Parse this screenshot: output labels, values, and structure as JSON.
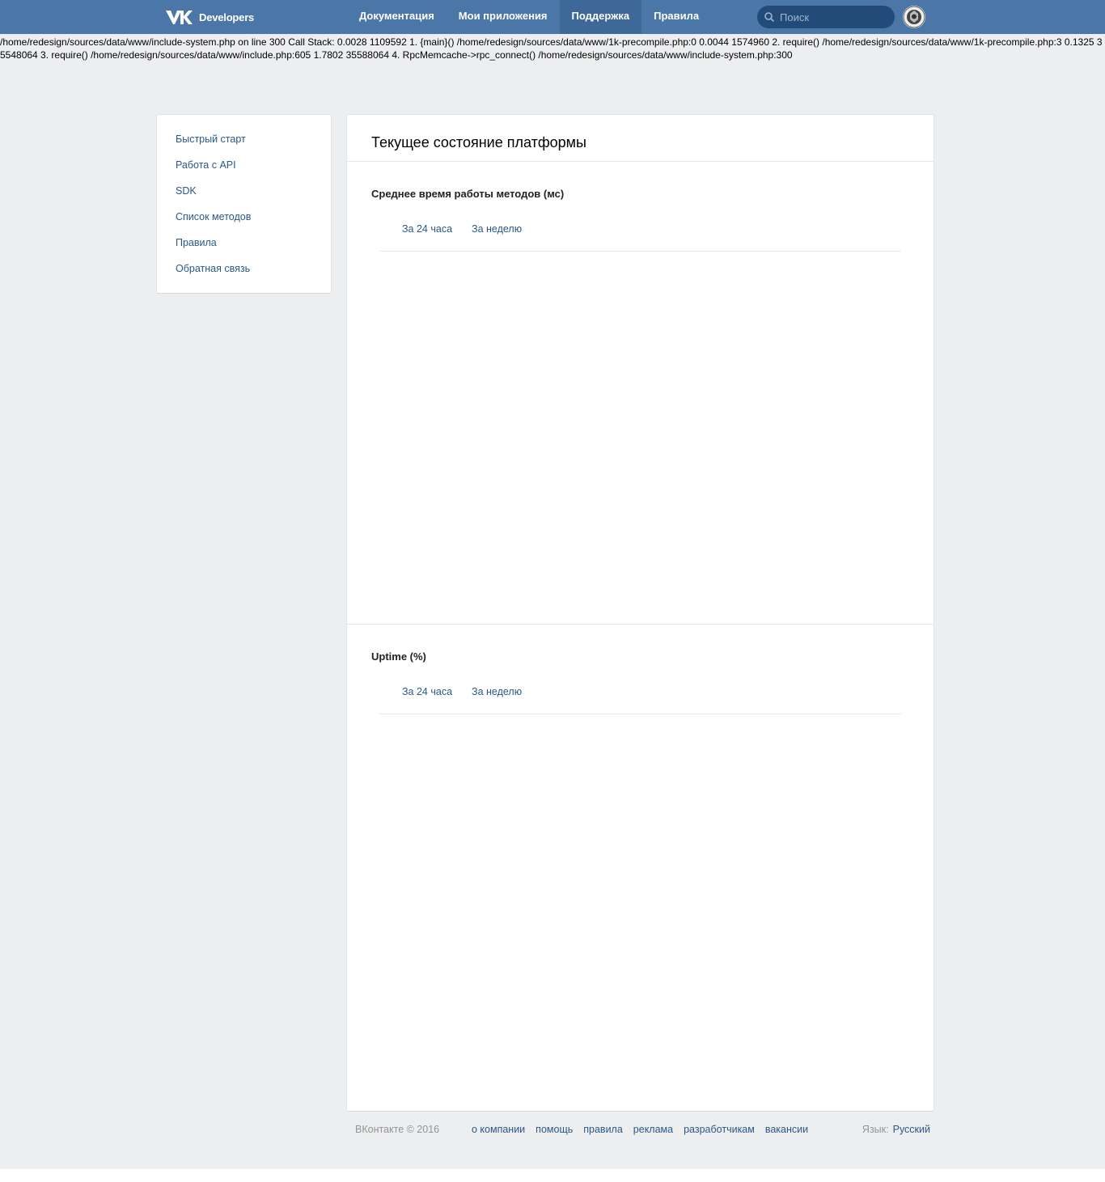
{
  "header": {
    "logo_text": "Developers",
    "nav": [
      {
        "label": "Документация",
        "active": false
      },
      {
        "label": "Мои приложения",
        "active": false
      },
      {
        "label": "Поддержка",
        "active": true
      },
      {
        "label": "Правила",
        "active": false
      }
    ],
    "search_placeholder": "Поиск"
  },
  "error_text": "/home/redesign/sources/data/www/include-system.php on line 300 Call Stack: 0.0028 1109592 1. {main}() /home/redesign/sources/data/www/1k-precompile.php:0 0.0044 1574960 2. require() /home/redesign/sources/data/www/1k-precompile.php:3 0.1325 35548064 3. require() /home/redesign/sources/data/www/include.php:605 1.7802 35588064 4. RpcMemcache->rpc_connect() /home/redesign/sources/data/www/include-system.php:300",
  "sidebar": {
    "items": [
      {
        "label": "Быстрый старт"
      },
      {
        "label": "Работа с API"
      },
      {
        "label": "SDK"
      },
      {
        "label": "Список методов"
      },
      {
        "label": "Правила"
      },
      {
        "label": "Обратная связь"
      }
    ]
  },
  "main": {
    "title": "Текущее состояние платформы",
    "sections": [
      {
        "title": "Среднее время работы методов (мс)",
        "tabs": [
          "За 24 часа",
          "За неделю"
        ]
      },
      {
        "title": "Uptime (%)",
        "tabs": [
          "За 24 часа",
          "За неделю"
        ]
      }
    ]
  },
  "footer": {
    "copyright": "ВКонтакте © 2016",
    "links": [
      "о компании",
      "помощь",
      "правила",
      "реклама",
      "разработчикам",
      "вакансии"
    ],
    "language_label": "Язык:",
    "language_value": "Русский"
  },
  "colors": {
    "header_bg": "#4a76a8",
    "link": "#2a5885",
    "page_bg": "#edeef0"
  }
}
